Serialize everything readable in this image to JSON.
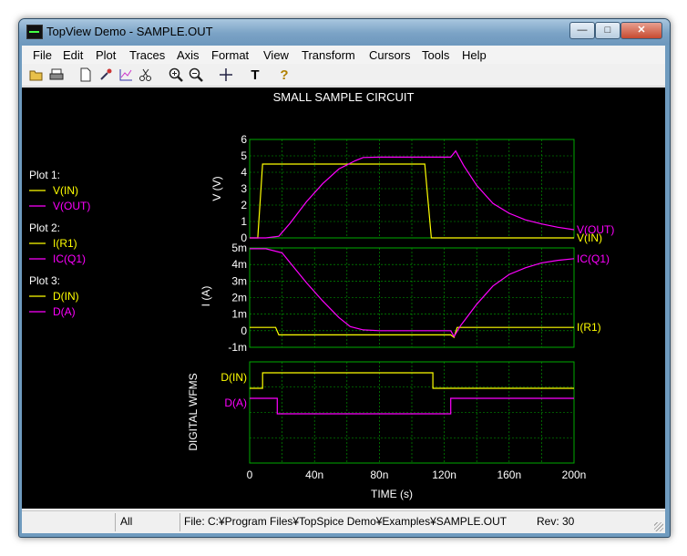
{
  "window": {
    "title": "TopView Demo - SAMPLE.OUT",
    "buttons": [
      "minimize-button",
      "maximize-button",
      "close-button"
    ]
  },
  "menu": [
    "File",
    "Edit",
    "Plot",
    "Traces",
    "Axis",
    "Format",
    "View",
    "Transform",
    "Cursors",
    "Tools",
    "Help"
  ],
  "toolbar": {
    "icons": [
      "open-folder-icon",
      "print-icon",
      "new-document-icon",
      "eyedropper-icon",
      "chart-icon",
      "scissors-icon",
      "zoom-in-icon",
      "zoom-out-icon",
      "crosshair-cursor-icon",
      "text-tool-icon",
      "help-icon"
    ]
  },
  "plot_title": "SMALL SAMPLE CIRCUIT",
  "legend": [
    {
      "heading": "Plot 1:",
      "entries": [
        {
          "label": "V(IN)",
          "color": "#ffff00"
        },
        {
          "label": "V(OUT)",
          "color": "#ff00ff"
        }
      ]
    },
    {
      "heading": "Plot 2:",
      "entries": [
        {
          "label": "I(R1)",
          "color": "#ffff00"
        },
        {
          "label": "IC(Q1)",
          "color": "#ff00ff"
        }
      ]
    },
    {
      "heading": "Plot 3:",
      "entries": [
        {
          "label": "D(IN)",
          "color": "#ffff00"
        },
        {
          "label": "D(A)",
          "color": "#ff00ff"
        }
      ]
    }
  ],
  "colors": {
    "background": "#000000",
    "grid": "#00aa00",
    "text": "#ffffff",
    "yellow": "#ffff00",
    "magenta": "#ff00ff"
  },
  "chart_data": [
    {
      "type": "line",
      "title": "SMALL SAMPLE CIRCUIT",
      "ylabel": "V  (V)",
      "ylim": [
        0,
        6
      ],
      "y_ticks": [
        "0",
        "1",
        "2",
        "3",
        "4",
        "5",
        "6"
      ],
      "xlim": [
        0,
        200
      ],
      "series": [
        {
          "name": "V(IN)",
          "color": "#ffff00",
          "x": [
            0,
            5,
            8,
            108,
            112,
            200
          ],
          "y": [
            0,
            0,
            4.5,
            4.5,
            0,
            0
          ]
        },
        {
          "name": "V(OUT)",
          "color": "#ff00ff",
          "x": [
            0,
            10,
            18,
            25,
            35,
            45,
            55,
            65,
            70,
            80,
            90,
            100,
            110,
            120,
            124,
            127,
            132,
            140,
            150,
            160,
            170,
            180,
            190,
            200
          ],
          "y": [
            0,
            0,
            0.1,
            0.9,
            2.2,
            3.3,
            4.2,
            4.7,
            4.9,
            4.92,
            4.92,
            4.92,
            4.92,
            4.92,
            4.92,
            5.3,
            4.4,
            3.2,
            2.1,
            1.5,
            1.1,
            0.85,
            0.65,
            0.5
          ]
        }
      ]
    },
    {
      "type": "line",
      "ylabel": "I  (A)",
      "ylim": [
        -1,
        5
      ],
      "y_ticks": [
        "-1m",
        "0",
        "1m",
        "2m",
        "3m",
        "4m",
        "5m"
      ],
      "xlim": [
        0,
        200
      ],
      "series": [
        {
          "name": "I(R1)",
          "color": "#ffff00",
          "x": [
            0,
            16,
            18,
            80,
            110,
            124,
            126,
            128,
            200
          ],
          "y": [
            0.2,
            0.2,
            -0.25,
            -0.25,
            -0.25,
            -0.25,
            -0.4,
            0.2,
            0.2
          ]
        },
        {
          "name": "IC(Q1)",
          "color": "#ff00ff",
          "x": [
            0,
            10,
            20,
            25,
            35,
            45,
            55,
            62,
            70,
            80,
            90,
            100,
            110,
            120,
            124,
            126,
            130,
            140,
            150,
            160,
            170,
            180,
            190,
            200
          ],
          "y": [
            4.95,
            4.95,
            4.7,
            4.1,
            2.9,
            1.8,
            0.8,
            0.25,
            0.05,
            0,
            0,
            0,
            0,
            0,
            0,
            -0.35,
            0.3,
            1.6,
            2.7,
            3.4,
            3.8,
            4.1,
            4.25,
            4.35
          ]
        }
      ]
    },
    {
      "type": "line",
      "ylabel": "DIGITAL WFMS",
      "xlabel": "TIME  (s)",
      "xlim": [
        0,
        200
      ],
      "x_ticks": [
        "0",
        "40n",
        "80n",
        "120n",
        "160n",
        "200n"
      ],
      "series": [
        {
          "name": "D(IN)",
          "color": "#ffff00",
          "x": [
            0,
            8,
            8,
            113,
            113,
            200
          ],
          "y": [
            0,
            0,
            1,
            1,
            0,
            0
          ]
        },
        {
          "name": "D(A)",
          "color": "#ff00ff",
          "x": [
            0,
            17,
            17,
            124,
            124,
            200
          ],
          "y": [
            1,
            1,
            0,
            0,
            1,
            1
          ]
        }
      ]
    }
  ],
  "status": {
    "mode": "All",
    "file": "File: C:¥Program Files¥TopSpice Demo¥Examples¥SAMPLE.OUT",
    "rev": "Rev: 30"
  }
}
